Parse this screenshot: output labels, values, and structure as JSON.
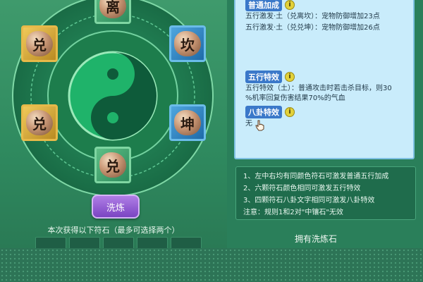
{
  "wheel": {
    "slots": {
      "top": "离",
      "upper_left": "兑",
      "upper_right": "坎",
      "lower_left": "兑",
      "lower_right": "坤",
      "bottom": "兑"
    }
  },
  "actions": {
    "wash_label": "洗炼"
  },
  "selection": {
    "hint": "本次获得以下符石（最多可选择两个）"
  },
  "info": {
    "bonus_heading": "普通加成",
    "bonus_lines": [
      "五行激发·土（兑离坎）：宠物防御增加23点",
      "五行激发·土（兑兑坤）：宠物防御增加26点"
    ],
    "element_heading": "五行特效",
    "element_lines": [
      "五行特效（土）：普通攻击时若击杀目标，则30",
      "%机率回复伤害结果70%的气血"
    ],
    "trigram_heading": "八卦特效",
    "trigram_value": "无",
    "info_icon": "i"
  },
  "rules": [
    "1、左中右均有同颜色符石可激发普通五行加成",
    "2、六颗符石颜色相同可激发五行特效",
    "3、四颗符石八卦文字相同可激发八卦特效",
    "注意：规则1和2对\"中镶石\"无效"
  ],
  "footer": {
    "own_label": "拥有洗炼石"
  },
  "colors": {
    "panel": "#c9ecfb",
    "heading": "#3a78c9",
    "button": "#8a55d1",
    "wheel": "#1c7d4d"
  }
}
